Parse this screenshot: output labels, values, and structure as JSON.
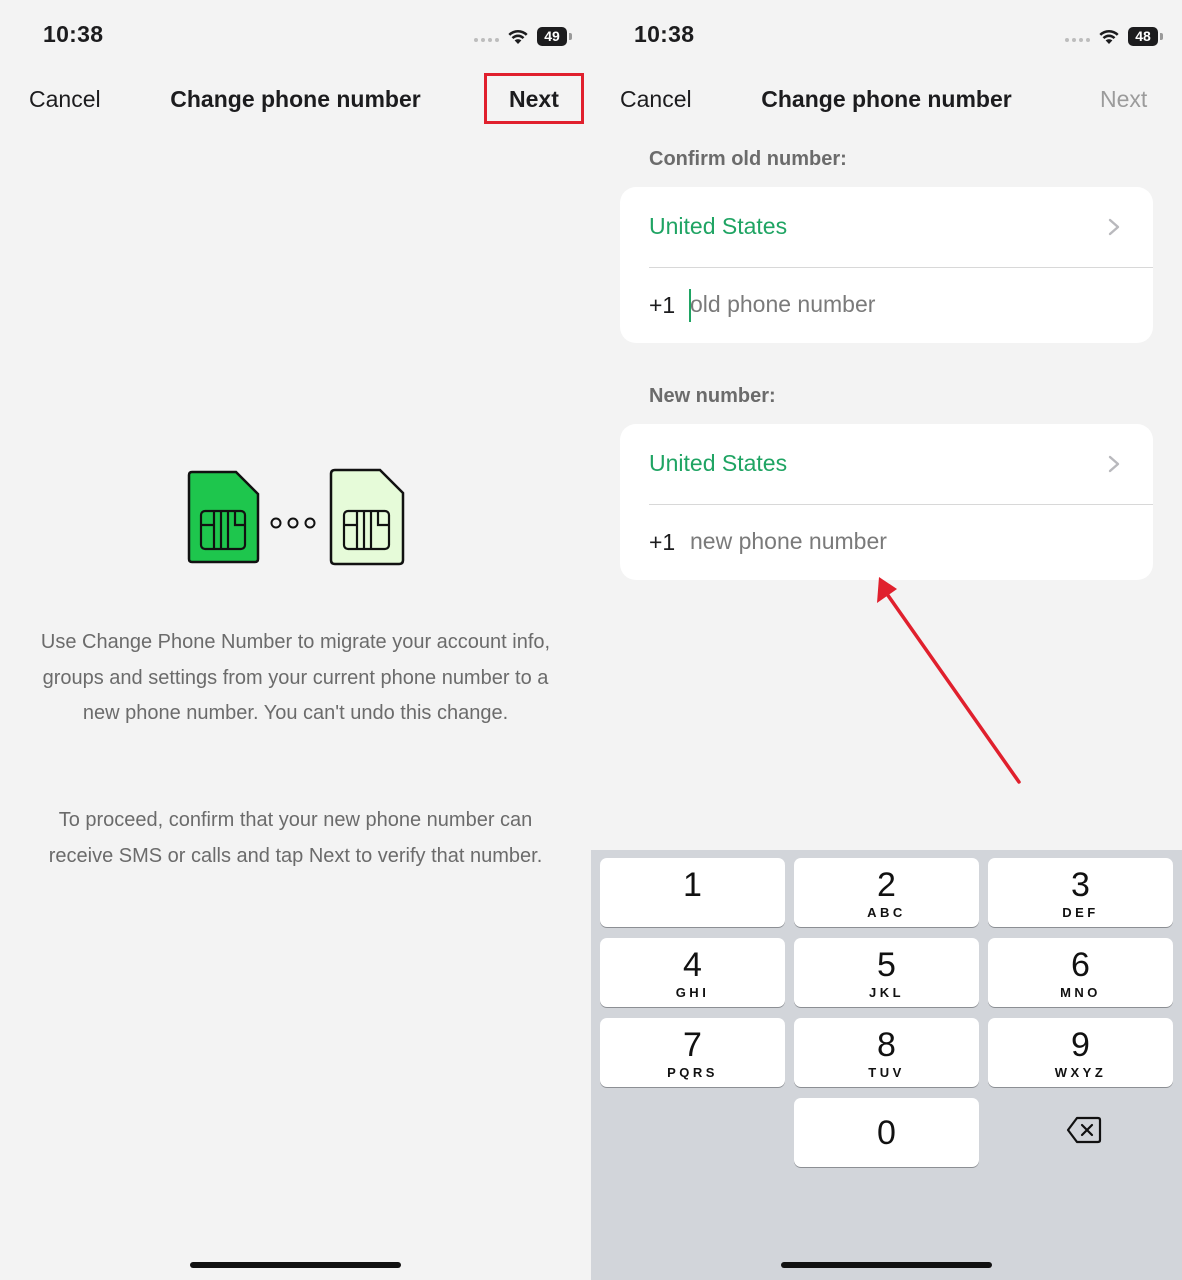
{
  "left": {
    "status": {
      "time": "10:38",
      "battery": "49"
    },
    "nav": {
      "cancel": "Cancel",
      "title": "Change phone number",
      "next": "Next"
    },
    "description_1": "Use Change Phone Number to migrate your account info, groups and settings from your current phone number to a new phone number. You can't undo this change.",
    "description_2": "To proceed, confirm that your new phone number can receive SMS or calls and tap Next to verify that number."
  },
  "right": {
    "status": {
      "time": "10:38",
      "battery": "48"
    },
    "nav": {
      "cancel": "Cancel",
      "title": "Change phone number",
      "next": "Next"
    },
    "old_section": {
      "label": "Confirm old number:",
      "country": "United States",
      "prefix": "+1",
      "placeholder": "old phone number"
    },
    "new_section": {
      "label": "New number:",
      "country": "United States",
      "prefix": "+1",
      "placeholder": "new phone number"
    },
    "keypad": [
      {
        "digit": "1",
        "letters": ""
      },
      {
        "digit": "2",
        "letters": "ABC"
      },
      {
        "digit": "3",
        "letters": "DEF"
      },
      {
        "digit": "4",
        "letters": "GHI"
      },
      {
        "digit": "5",
        "letters": "JKL"
      },
      {
        "digit": "6",
        "letters": "MNO"
      },
      {
        "digit": "7",
        "letters": "PQRS"
      },
      {
        "digit": "8",
        "letters": "TUV"
      },
      {
        "digit": "9",
        "letters": "WXYZ"
      },
      {
        "digit": "0",
        "letters": ""
      }
    ]
  },
  "colors": {
    "accent": "#1fa463",
    "annotation": "#e0202d",
    "sim_dark": "#1ec64d",
    "sim_light": "#e6fbd9"
  },
  "icons": [
    "wifi-icon",
    "battery-icon",
    "sim-card-icon",
    "chevron-right-icon",
    "backspace-icon"
  ]
}
